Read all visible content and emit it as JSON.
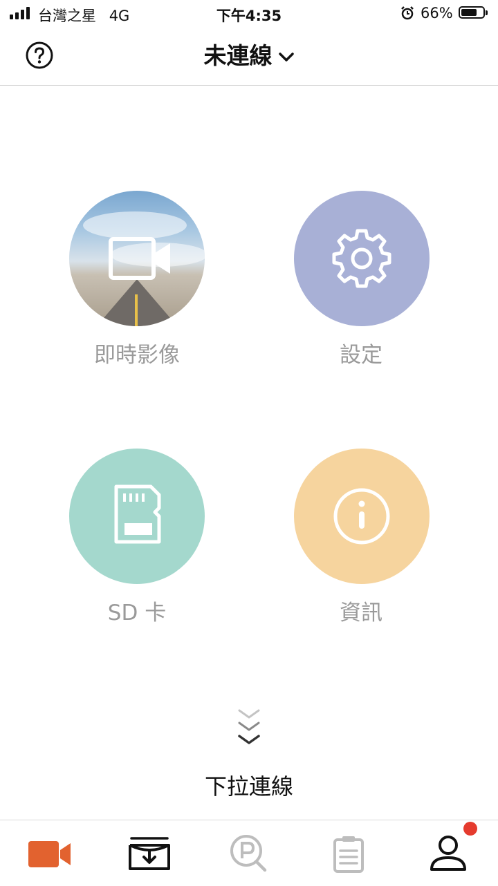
{
  "status_bar": {
    "carrier": "台灣之星",
    "network": "4G",
    "time": "下午4:35",
    "battery": "66%",
    "battery_level": 0.66
  },
  "header": {
    "title": "未連線",
    "help_icon": "question-circle-icon",
    "dropdown_icon": "chevron-down-icon"
  },
  "tiles": [
    {
      "label": "即時影像",
      "icon": "video-camera-icon",
      "color": "#7aa7d0"
    },
    {
      "label": "設定",
      "icon": "gear-icon",
      "color": "#a8b0d6"
    },
    {
      "label": "SD 卡",
      "icon": "sd-card-icon",
      "color": "#a4d8cd"
    },
    {
      "label": "資訊",
      "icon": "info-icon",
      "color": "#f6d49e"
    }
  ],
  "pull": {
    "label": "下拉連線",
    "icon": "double-chevron-down-icon"
  },
  "tabbar": {
    "items": [
      {
        "icon": "video-camera-icon",
        "active": true
      },
      {
        "icon": "download-tray-icon",
        "active": false
      },
      {
        "icon": "parking-search-icon",
        "active": false
      },
      {
        "icon": "clipboard-icon",
        "active": false
      },
      {
        "icon": "user-icon",
        "active": false,
        "badge": true
      }
    ],
    "accent": "#e2622f"
  }
}
